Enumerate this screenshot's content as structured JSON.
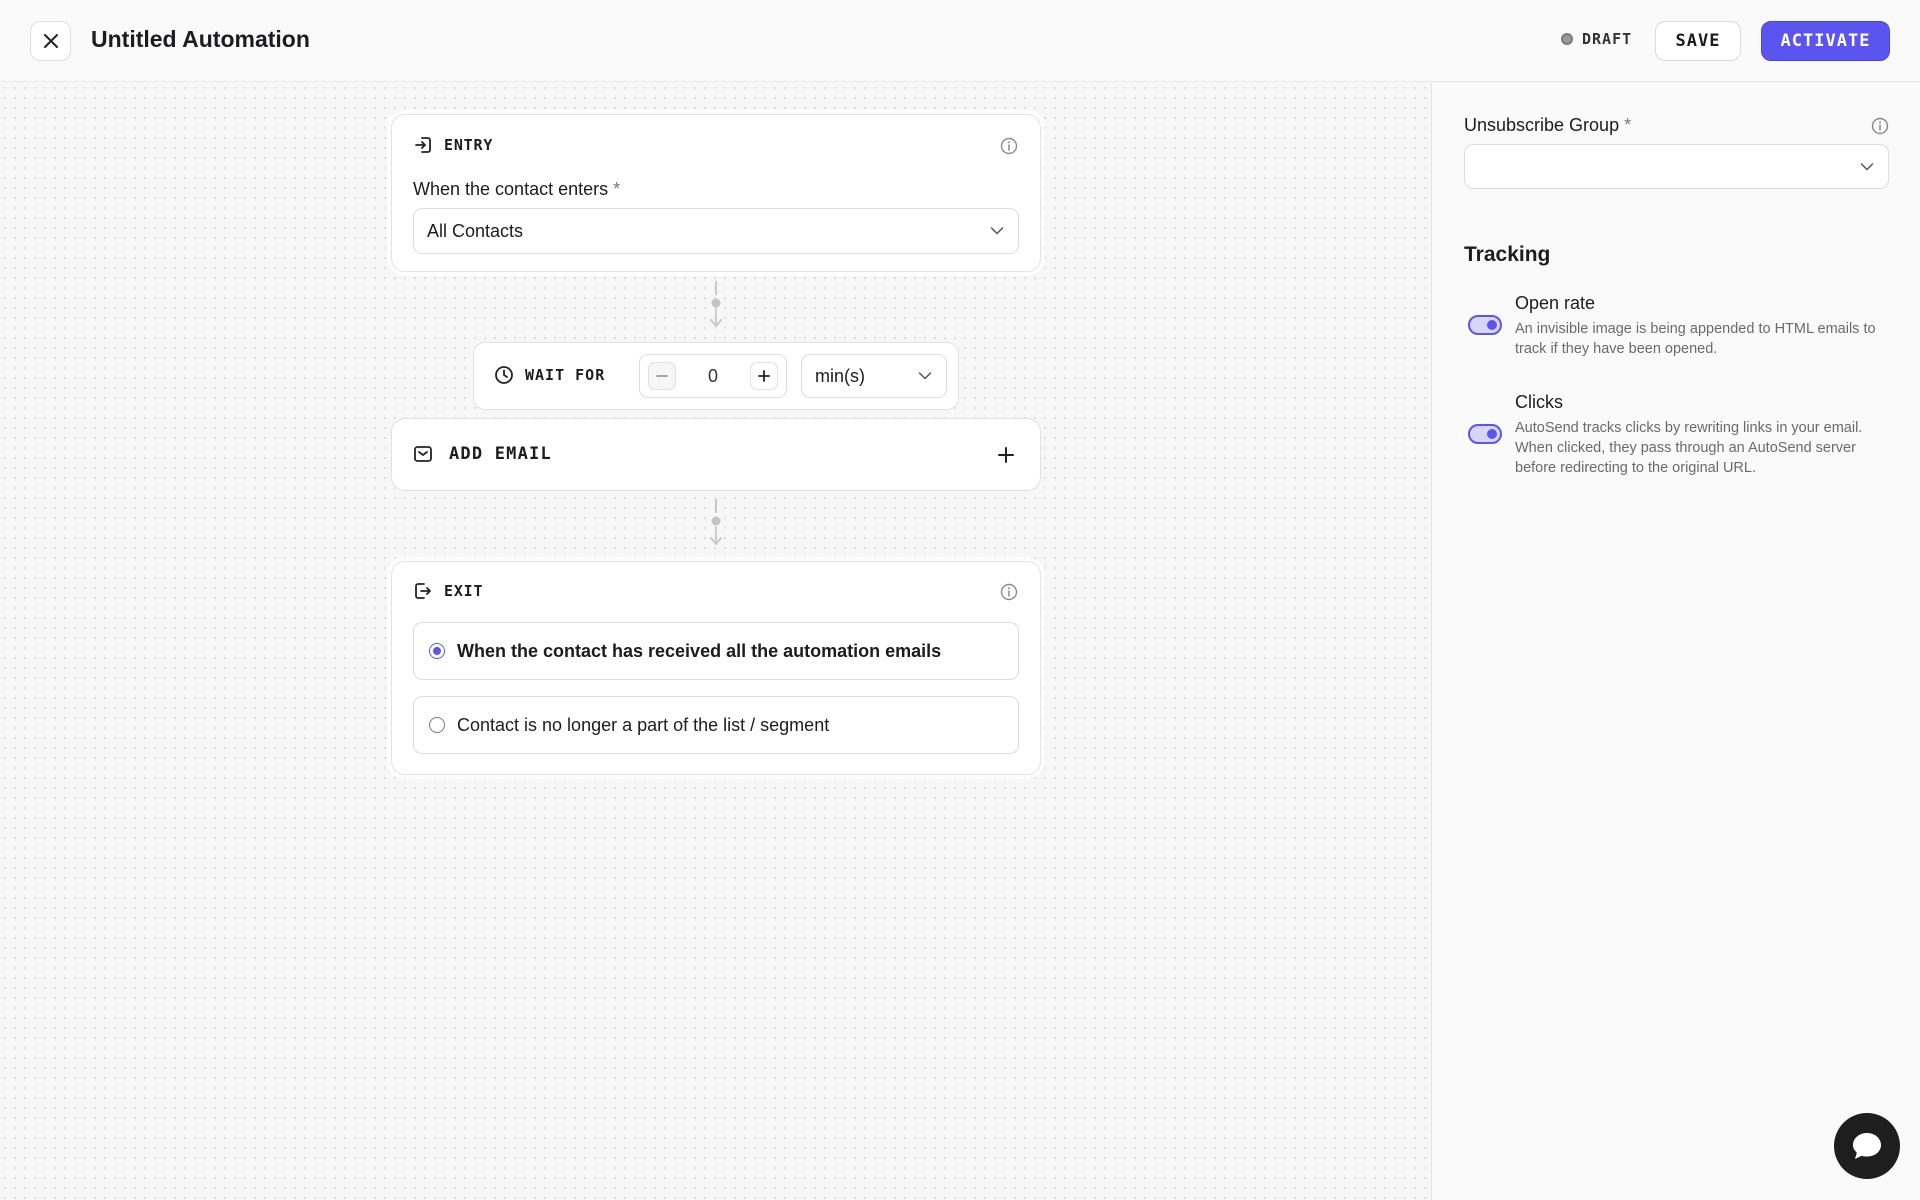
{
  "header": {
    "title": "Untitled Automation",
    "status": "DRAFT",
    "save_label": "SAVE",
    "activate_label": "ACTIVATE"
  },
  "entry": {
    "heading": "ENTRY",
    "field_label": "When the contact enters",
    "required_mark": "*",
    "selected_value": "All Contacts"
  },
  "wait": {
    "label": "WAIT FOR",
    "value": "0",
    "unit": "min(s)"
  },
  "add_email": {
    "label": "ADD EMAIL"
  },
  "exit": {
    "heading": "EXIT",
    "options": [
      {
        "label": "When the contact has received all the automation emails",
        "selected": true
      },
      {
        "label": "Contact is no longer a part of the list / segment",
        "selected": false
      }
    ]
  },
  "panel": {
    "unsubscribe_label": "Unsubscribe Group",
    "required_mark": "*",
    "unsubscribe_value": "",
    "tracking_title": "Tracking",
    "open_rate": {
      "title": "Open rate",
      "description": "An invisible image is being appended to HTML emails to track if they have been opened.",
      "enabled": true
    },
    "clicks": {
      "title": "Clicks",
      "description": "AutoSend tracks clicks by rewriting links in your email. When clicked, they pass through an AutoSend server before redirecting to the original URL.",
      "enabled": true
    }
  },
  "colors": {
    "accent": "#5a55f0",
    "status_dot": "#9a9a9a",
    "chat_button": "#1e1e1e"
  }
}
